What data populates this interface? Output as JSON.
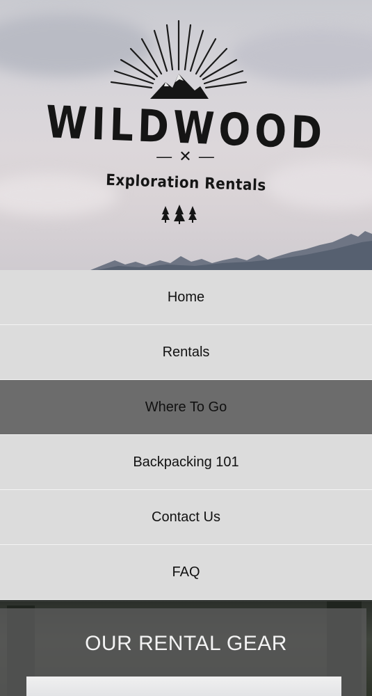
{
  "brand": {
    "name": "WILDWOOD",
    "separator": "— ✕ —",
    "tagline": "Exploration Rentals",
    "logo_icon": "sunburst-mountain-icon",
    "trees_icon": "pine-trees-icon"
  },
  "nav": {
    "items": [
      {
        "label": "Home",
        "active": false
      },
      {
        "label": "Rentals",
        "active": false
      },
      {
        "label": "Where To Go",
        "active": true
      },
      {
        "label": "Backpacking 101",
        "active": false
      },
      {
        "label": "Contact Us",
        "active": false
      },
      {
        "label": "FAQ",
        "active": false
      }
    ]
  },
  "section": {
    "title": "OUR RENTAL GEAR"
  },
  "colors": {
    "nav_bg": "#dcdcdc",
    "nav_active_bg": "#6c6c6c",
    "section_panel": "#5a5a5a"
  }
}
